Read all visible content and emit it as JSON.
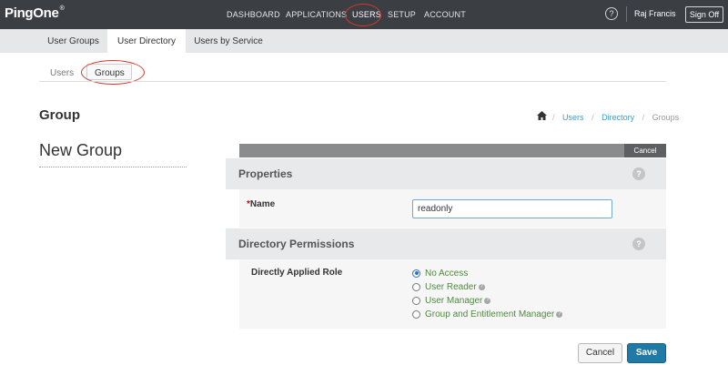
{
  "topbar": {
    "logo": "PingOne",
    "logo_sup": "®",
    "nav": {
      "dashboard": "DASHBOARD",
      "applications": "APPLICATIONS",
      "users": "USERS",
      "setup": "SETUP",
      "account": "ACCOUNT"
    },
    "help": "?",
    "user_name": "Raj Francis",
    "sign_off": "Sign Off"
  },
  "tabs": {
    "user_groups": "User Groups",
    "user_directory": "User Directory",
    "users_by_service": "Users by Service"
  },
  "subtabs": {
    "users": "Users",
    "groups": "Groups"
  },
  "page": {
    "title": "Group",
    "heading": "New Group"
  },
  "breadcrumb": {
    "users": "Users",
    "directory": "Directory",
    "groups": "Groups",
    "sep": "/"
  },
  "form": {
    "cancel_top": "Cancel",
    "properties": {
      "title": "Properties",
      "help": "?",
      "name_required": "*",
      "name_label": "Name",
      "name_value": "readonly"
    },
    "permissions": {
      "title": "Directory Permissions",
      "help": "?",
      "role_label": "Directly Applied Role",
      "options": [
        {
          "label": "No Access",
          "selected": true,
          "has_help": false
        },
        {
          "label": "User Reader",
          "selected": false,
          "has_help": true
        },
        {
          "label": "User Manager",
          "selected": false,
          "has_help": true
        },
        {
          "label": "Group and Entitlement Manager",
          "selected": false,
          "has_help": true
        }
      ],
      "mini_help": "?"
    },
    "cancel_button": "Cancel",
    "save_button": "Save"
  },
  "colors": {
    "topbar_bg": "#3b3e43",
    "annotation_red": "#d23a2e",
    "link_blue": "#3b9dc7",
    "save_blue": "#1f7aa5",
    "option_green": "#4f8a3f",
    "required_red": "#d0021b"
  }
}
